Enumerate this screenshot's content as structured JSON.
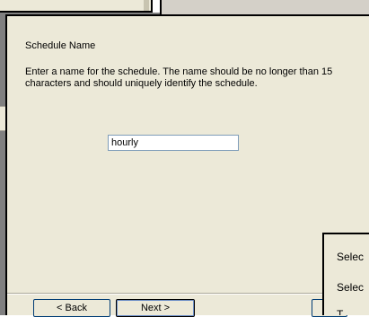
{
  "wizard": {
    "page_title": "Schedule Name",
    "description": "Enter a name for the schedule. The name should be no longer than 15 characters and should uniquely identify the schedule.",
    "name_value": "hourly",
    "back_label": "< Back",
    "next_label": "Next >",
    "cancel_label": "C"
  },
  "popup": {
    "items": [
      "Selec",
      "Selec",
      "T"
    ]
  }
}
